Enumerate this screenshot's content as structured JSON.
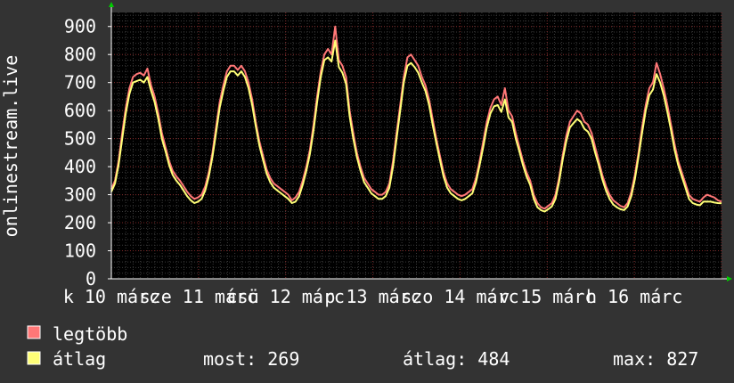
{
  "chart_data": {
    "type": "line",
    "ylabel": "onlinestream.live",
    "ylim": [
      0,
      950
    ],
    "yticks": [
      0,
      100,
      200,
      300,
      400,
      500,
      600,
      700,
      800,
      900
    ],
    "x_tick_labels": [
      "k 10 márc",
      "sze 11 márc",
      "csü 12 márc",
      "p 13 márc",
      "szo 14 márc",
      "v 15 márc",
      "h 16 márc"
    ],
    "days_shown": 7,
    "grid": true,
    "colors": {
      "background": "#333333",
      "plot_background": "#000000",
      "grid_major": "#7a2424",
      "grid_minor": "#3a3a3a",
      "axis": "#ffffff",
      "max_series": "#ff7777",
      "avg_series": "#ffff77",
      "arrow": "#00cc00"
    },
    "series": [
      {
        "name": "legtöbb",
        "color": "#ff7777",
        "values": [
          320,
          350,
          420,
          520,
          610,
          680,
          720,
          730,
          735,
          725,
          750,
          690,
          650,
          590,
          520,
          470,
          420,
          385,
          365,
          350,
          330,
          310,
          295,
          285,
          290,
          300,
          330,
          380,
          450,
          540,
          630,
          690,
          740,
          760,
          760,
          745,
          760,
          740,
          700,
          640,
          560,
          490,
          440,
          390,
          360,
          340,
          330,
          320,
          310,
          300,
          280,
          290,
          310,
          350,
          400,
          460,
          550,
          650,
          740,
          800,
          820,
          800,
          900,
          780,
          760,
          720,
          600,
          520,
          450,
          400,
          360,
          340,
          320,
          310,
          300,
          300,
          310,
          340,
          420,
          520,
          620,
          720,
          790,
          800,
          780,
          760,
          720,
          690,
          640,
          570,
          500,
          440,
          380,
          340,
          320,
          310,
          300,
          295,
          300,
          310,
          320,
          360,
          420,
          490,
          560,
          610,
          640,
          650,
          620,
          680,
          600,
          580,
          520,
          470,
          420,
          380,
          350,
          300,
          270,
          255,
          250,
          260,
          270,
          300,
          360,
          440,
          510,
          560,
          580,
          600,
          590,
          560,
          550,
          520,
          470,
          420,
          370,
          330,
          300,
          280,
          270,
          260,
          255,
          270,
          310,
          370,
          450,
          540,
          620,
          680,
          700,
          770,
          730,
          680,
          620,
          550,
          480,
          420,
          380,
          340,
          300,
          285,
          280,
          275,
          290,
          300,
          295,
          290,
          280,
          275
        ]
      },
      {
        "name": "átlag",
        "color": "#ffff77",
        "values": [
          310,
          340,
          405,
          500,
          590,
          660,
          700,
          705,
          710,
          700,
          720,
          670,
          630,
          570,
          500,
          455,
          405,
          370,
          350,
          335,
          315,
          295,
          280,
          270,
          275,
          285,
          315,
          365,
          435,
          520,
          610,
          670,
          720,
          740,
          740,
          725,
          740,
          720,
          680,
          620,
          545,
          475,
          425,
          375,
          345,
          325,
          315,
          305,
          295,
          285,
          270,
          275,
          295,
          335,
          385,
          445,
          530,
          630,
          720,
          780,
          790,
          775,
          850,
          755,
          735,
          695,
          580,
          500,
          435,
          385,
          345,
          325,
          305,
          295,
          285,
          285,
          295,
          325,
          400,
          500,
          600,
          700,
          760,
          770,
          755,
          735,
          700,
          670,
          620,
          550,
          485,
          425,
          365,
          325,
          305,
          295,
          285,
          280,
          285,
          295,
          305,
          345,
          405,
          470,
          540,
          590,
          615,
          620,
          595,
          640,
          575,
          560,
          500,
          455,
          405,
          365,
          335,
          285,
          255,
          245,
          240,
          248,
          258,
          285,
          345,
          425,
          490,
          540,
          555,
          570,
          560,
          535,
          525,
          500,
          450,
          405,
          355,
          315,
          285,
          265,
          255,
          248,
          245,
          258,
          295,
          355,
          435,
          520,
          600,
          655,
          675,
          730,
          700,
          655,
          595,
          530,
          460,
          405,
          365,
          325,
          285,
          270,
          265,
          262,
          275,
          275,
          275,
          272,
          270,
          269
        ]
      }
    ],
    "legend": [
      {
        "label": "legtöbb",
        "color": "#ff7777"
      },
      {
        "label": "átlag",
        "color": "#ffff77"
      }
    ],
    "stats": {
      "now_text": "most: 269",
      "avg_text": "átlag: 484",
      "max_text": "max: 827"
    }
  }
}
